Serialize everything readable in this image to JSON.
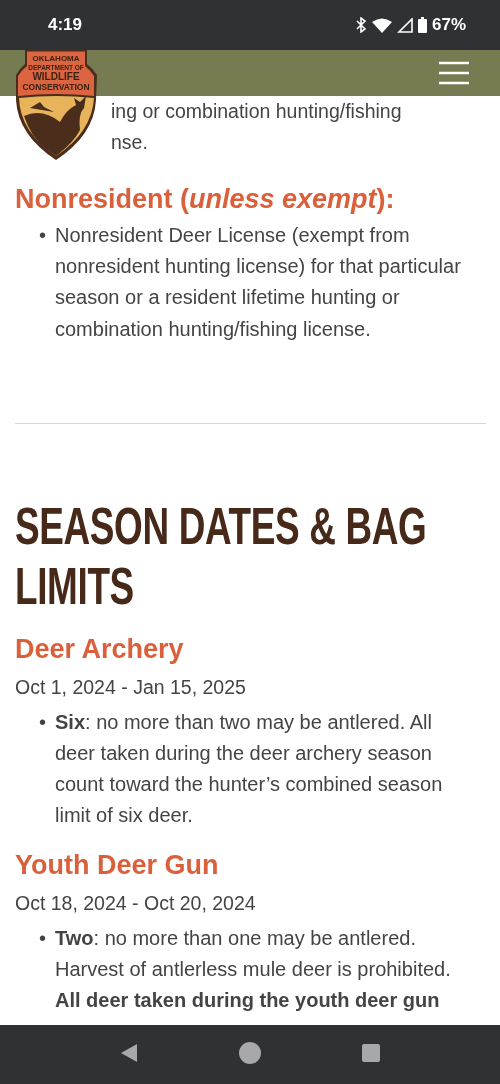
{
  "status_bar": {
    "time": "4:19",
    "battery": "67%"
  },
  "header": {
    "logo": {
      "lines": [
        "OKLAHOMA",
        "DEPARTMENT OF",
        "WILDLIFE",
        "CONSERVATION"
      ]
    }
  },
  "partial_text": [
    "ing or combination hunting/fishing",
    "nse."
  ],
  "nonresident": {
    "heading": "Nonresident (*unless exempt*):",
    "bullets": [
      {
        "marker": "•",
        "text": "Nonresident Deer License (exempt from nonresident hunting license) for that particular season or a resident lifetime hunting or combination hunting/fishing license."
      }
    ]
  },
  "section_title": "SEASON DATES & BAG LIMITS",
  "seasons": [
    {
      "name": "Deer Archery",
      "dates": "Oct 1, 2024 - Jan 15, 2025",
      "bullets": [
        {
          "marker": "•",
          "text": "**Six**: no more than two may be antlered. All deer taken during the deer archery season count toward the hunter’s combined season limit of six deer."
        }
      ]
    },
    {
      "name": "Youth Deer Gun",
      "dates": "Oct 18, 2024 - Oct 20, 2024",
      "bullets": [
        {
          "marker": "•",
          "text": "**Two**: no more than one may be antlered. Harvest of antlerless mule deer is prohibited. **All deer taken during the youth deer gun**"
        }
      ]
    }
  ]
}
